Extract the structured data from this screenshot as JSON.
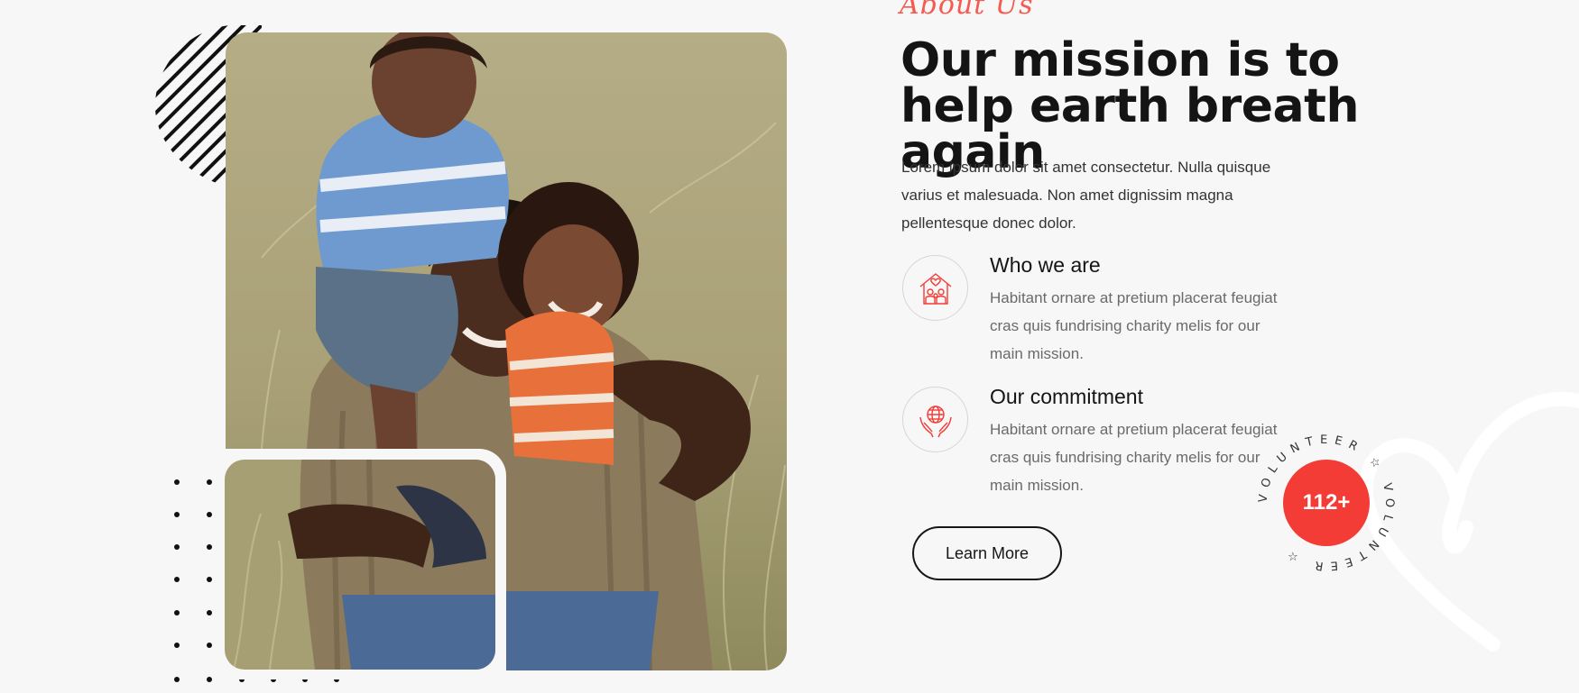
{
  "about": {
    "eyebrow": "About Us",
    "headline": "Our mission is to help earth breath again",
    "intro": "Lorem ipsum dolor sit amet consectetur. Nulla quisque varius et malesuada. Non amet dignissim magna pellentesque donec dolor."
  },
  "features": [
    {
      "icon": "family-house-icon",
      "title": "Who we are",
      "description": "Habitant ornare at pretium placerat feugiat cras quis fundrising charity melis for our main mission."
    },
    {
      "icon": "hands-globe-icon",
      "title": "Our commitment",
      "description": "Habitant ornare at pretium placerat feugiat cras quis fundrising charity melis for our main mission."
    }
  ],
  "cta": {
    "label": "Learn More"
  },
  "volunteer": {
    "count": "112+",
    "ring_text": "VOLUNTEER ☆ VOLUNTEER ☆"
  },
  "colors": {
    "accent": "#f33c36",
    "eyebrow": "#f45a4f",
    "background": "#f7f7f7",
    "text_dark": "#141414",
    "text_muted": "#6a6a6a"
  }
}
